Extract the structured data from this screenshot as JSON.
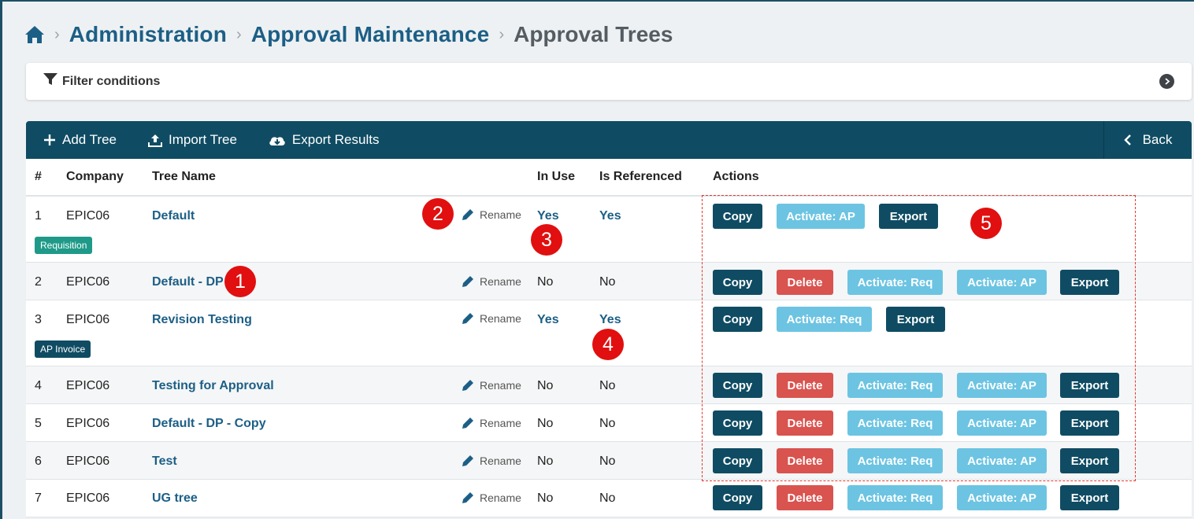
{
  "breadcrumb": {
    "items": [
      "Administration",
      "Approval Maintenance"
    ],
    "current": "Approval Trees"
  },
  "filter": {
    "label": "Filter conditions"
  },
  "toolbar": {
    "add_tree": "Add Tree",
    "import_tree": "Import Tree",
    "export_results": "Export Results",
    "back": "Back"
  },
  "table": {
    "headers": {
      "num": "#",
      "company": "Company",
      "tree_name": "Tree Name",
      "in_use": "In Use",
      "is_referenced": "Is Referenced",
      "actions": "Actions"
    },
    "rename_label": "Rename",
    "rows": [
      {
        "num": "1",
        "company": "EPIC06",
        "name": "Default",
        "in_use": "Yes",
        "referenced": "Yes",
        "tag": "Requisition",
        "actions": [
          "Copy",
          "Activate: AP",
          "Export"
        ]
      },
      {
        "num": "2",
        "company": "EPIC06",
        "name": "Default - DP",
        "in_use": "No",
        "referenced": "No",
        "tag": "",
        "actions": [
          "Copy",
          "Delete",
          "Activate: Req",
          "Activate: AP",
          "Export"
        ]
      },
      {
        "num": "3",
        "company": "EPIC06",
        "name": "Revision Testing",
        "in_use": "Yes",
        "referenced": "Yes",
        "tag": "AP Invoice",
        "actions": [
          "Copy",
          "Activate: Req",
          "Export"
        ]
      },
      {
        "num": "4",
        "company": "EPIC06",
        "name": "Testing for Approval",
        "in_use": "No",
        "referenced": "No",
        "tag": "",
        "actions": [
          "Copy",
          "Delete",
          "Activate: Req",
          "Activate: AP",
          "Export"
        ]
      },
      {
        "num": "5",
        "company": "EPIC06",
        "name": "Default - DP - Copy",
        "in_use": "No",
        "referenced": "No",
        "tag": "",
        "actions": [
          "Copy",
          "Delete",
          "Activate: Req",
          "Activate: AP",
          "Export"
        ]
      },
      {
        "num": "6",
        "company": "EPIC06",
        "name": "Test",
        "in_use": "No",
        "referenced": "No",
        "tag": "",
        "actions": [
          "Copy",
          "Delete",
          "Activate: Req",
          "Activate: AP",
          "Export"
        ]
      },
      {
        "num": "7",
        "company": "EPIC06",
        "name": "UG tree",
        "in_use": "No",
        "referenced": "No",
        "tag": "",
        "actions": [
          "Copy",
          "Delete",
          "Activate: Req",
          "Activate: AP",
          "Export"
        ]
      }
    ]
  },
  "annotations": [
    "1",
    "2",
    "3",
    "4",
    "5"
  ],
  "colors": {
    "primary": "#0f4c63",
    "link": "#1c5f86",
    "delete": "#d9534f",
    "activate": "#6cc4e2",
    "requisition_tag": "#1f9a89",
    "callout": "#e10f0f"
  },
  "icons": [
    "home-icon",
    "filter-icon",
    "chevron-right-icon",
    "plus-icon",
    "upload-icon",
    "cloud-download-icon",
    "chevron-left-icon",
    "pencil-icon"
  ]
}
